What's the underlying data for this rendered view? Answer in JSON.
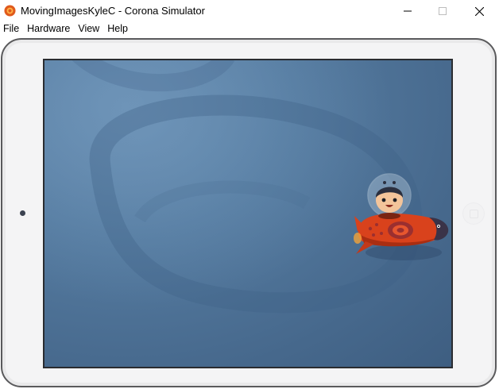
{
  "window": {
    "title": "MovingImagesKyleC - Corona Simulator",
    "icon": "corona-logo-icon",
    "controls": {
      "minimize": "minimize-icon",
      "maximize": "maximize-icon",
      "close": "close-icon"
    }
  },
  "menu": {
    "items": [
      {
        "label": "File"
      },
      {
        "label": "Hardware"
      },
      {
        "label": "View"
      },
      {
        "label": "Help"
      }
    ]
  },
  "device": {
    "skin": "iPad",
    "frame_color": "#f4f4f5",
    "screen_color": "#4f7399",
    "sprite": "astronaut-rocket-image"
  }
}
